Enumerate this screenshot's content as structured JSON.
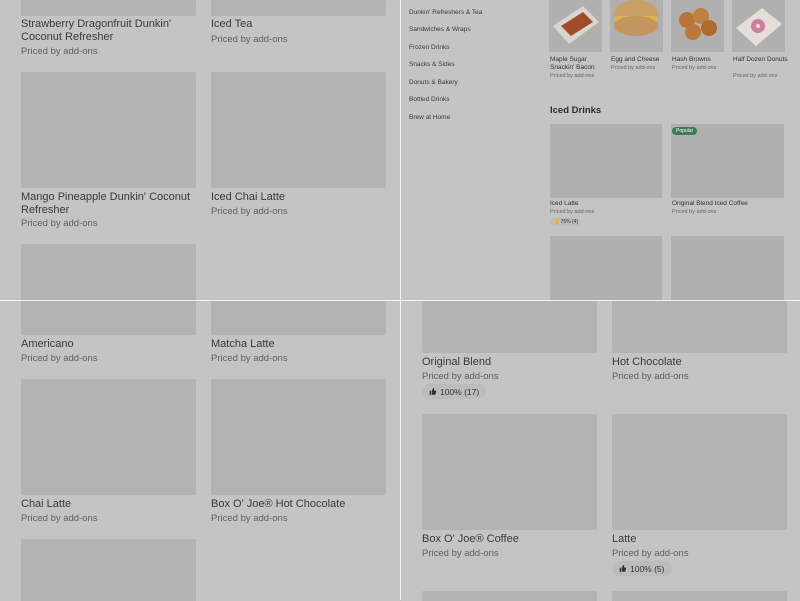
{
  "q1": {
    "items": [
      {
        "name": "Strawberry Dragonfruit Dunkin' Coconut Refresher",
        "price": "Priced by add-ons"
      },
      {
        "name": "Iced Tea",
        "price": "Priced by add-ons"
      },
      {
        "name": "Mango Pineapple Dunkin' Coconut Refresher",
        "price": "Priced by add-ons"
      },
      {
        "name": "Iced Chai Latte",
        "price": "Priced by add-ons"
      }
    ]
  },
  "q2": {
    "nav": [
      "Dunkin' Refreshers & Tea",
      "Sandwiches & Wraps",
      "Frozen Drinks",
      "Snacks & Sides",
      "Donuts & Bakery",
      "Bottled Drinks",
      "Brew at Home"
    ],
    "top_items": [
      {
        "name": "Maple Sugar Snackin' Bacon",
        "price": "Priced by add-ons"
      },
      {
        "name": "Egg and Cheese",
        "price": "Priced by add-ons"
      },
      {
        "name": "Hash Browns",
        "price": "Priced by add-ons"
      },
      {
        "name": "Half Dozen Donuts",
        "price": "Priced by add-ons"
      }
    ],
    "section_title": "Iced Drinks",
    "iced_items": [
      {
        "name": "Iced Latte",
        "price": "Priced by add-ons",
        "rating": "75% (4)"
      },
      {
        "name": "Original Blend Iced Coffee",
        "price": "Priced by add-ons",
        "badge": "Popular"
      }
    ]
  },
  "q3": {
    "items": [
      {
        "name": "Americano",
        "price": "Priced by add-ons"
      },
      {
        "name": "Matcha Latte",
        "price": "Priced by add-ons"
      },
      {
        "name": "Chai Latte",
        "price": "Priced by add-ons"
      },
      {
        "name": "Box O' Joe® Hot Chocolate",
        "price": "Priced by add-ons"
      }
    ]
  },
  "q4": {
    "items": [
      {
        "name": "Original Blend",
        "price": "Priced by add-ons",
        "rating": "100% (17)"
      },
      {
        "name": "Hot Chocolate",
        "price": "Priced by add-ons"
      },
      {
        "name": "Box O' Joe® Coffee",
        "price": "Priced by add-ons"
      },
      {
        "name": "Latte",
        "price": "Priced by add-ons",
        "rating": "100% (5)"
      }
    ]
  },
  "icons": {
    "rating": "thumbs-up-icon"
  }
}
